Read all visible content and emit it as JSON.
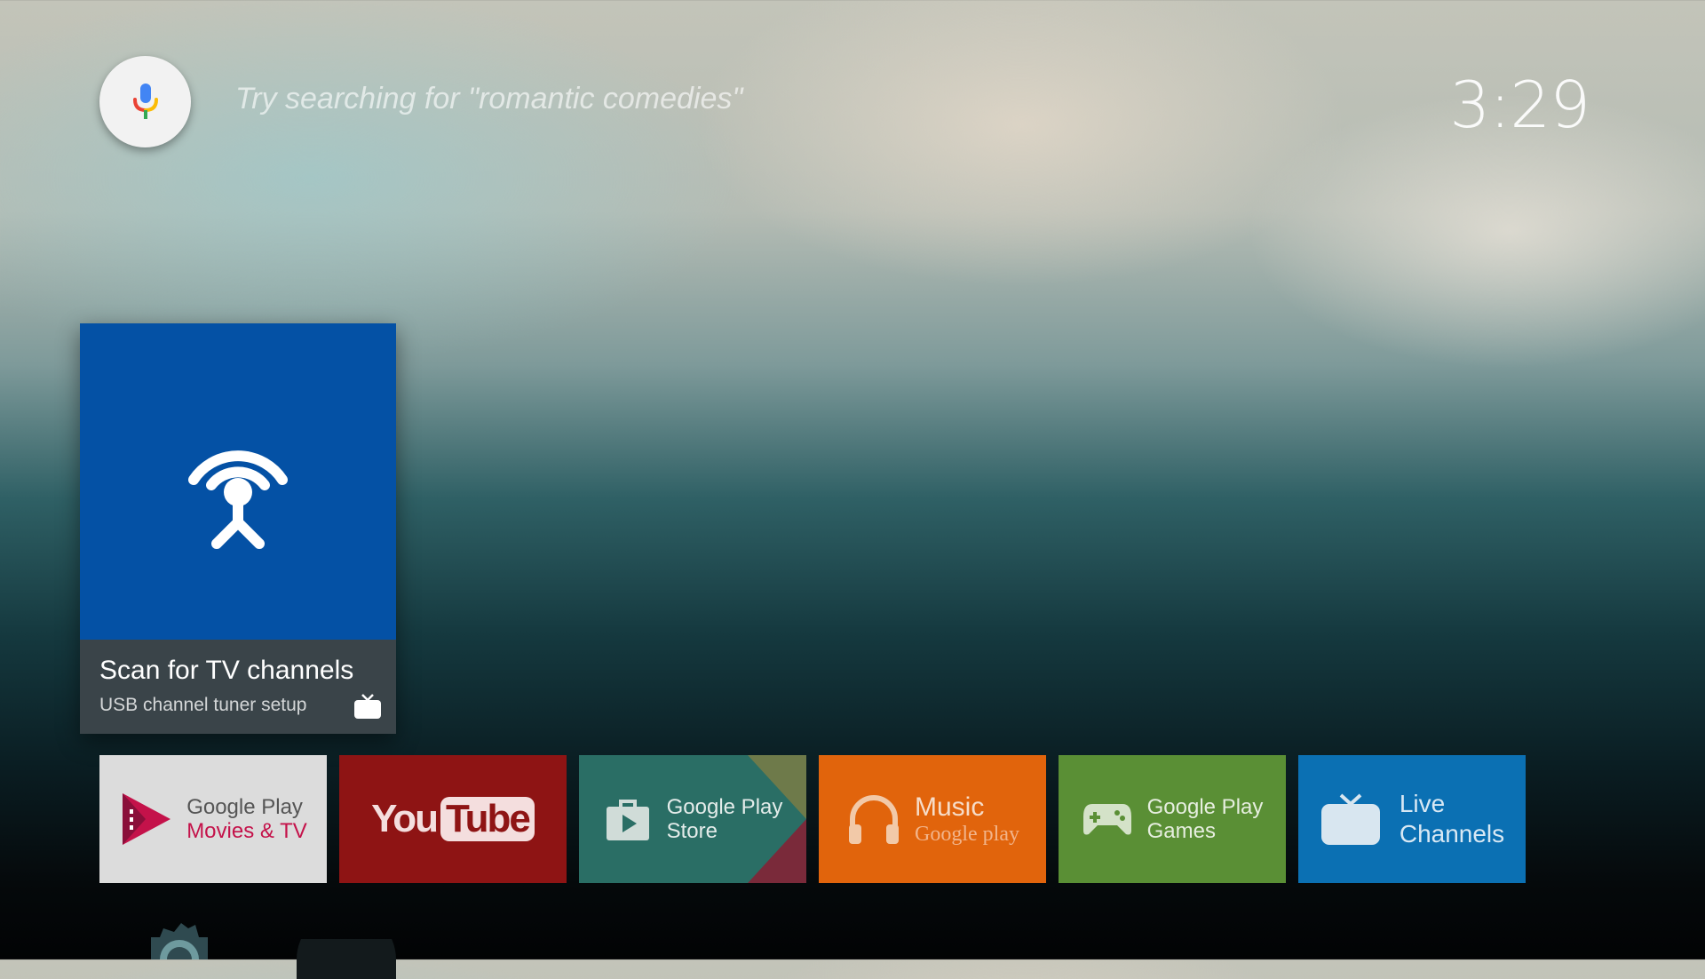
{
  "search": {
    "hint": "Try searching for \"romantic comedies\"",
    "mic_icon": "mic-icon"
  },
  "clock": {
    "time": "3:29"
  },
  "featured": {
    "title": "Scan for TV channels",
    "subtitle": "USB channel tuner setup",
    "art_icon": "antenna-broadcast-icon",
    "badge_icon": "tv-icon",
    "art_color": "#0451a5"
  },
  "apps": {
    "movies": {
      "line1": "Google Play",
      "line2": "Movies & TV"
    },
    "youtube": {
      "logo_you": "You",
      "logo_tube": "Tube"
    },
    "store": {
      "line1": "Google Play",
      "line2": "Store"
    },
    "music": {
      "line1": "Music",
      "line2": "Google play"
    },
    "games": {
      "line1": "Google Play",
      "line2": "Games"
    },
    "live": {
      "line1": "Live",
      "line2": "Channels"
    }
  },
  "colors": {
    "movies_accent": "#c4124a",
    "youtube": "#8e1414",
    "store": "#2a6e65",
    "music": "#e1640c",
    "games": "#5a8f35",
    "live": "#0b70b3"
  }
}
